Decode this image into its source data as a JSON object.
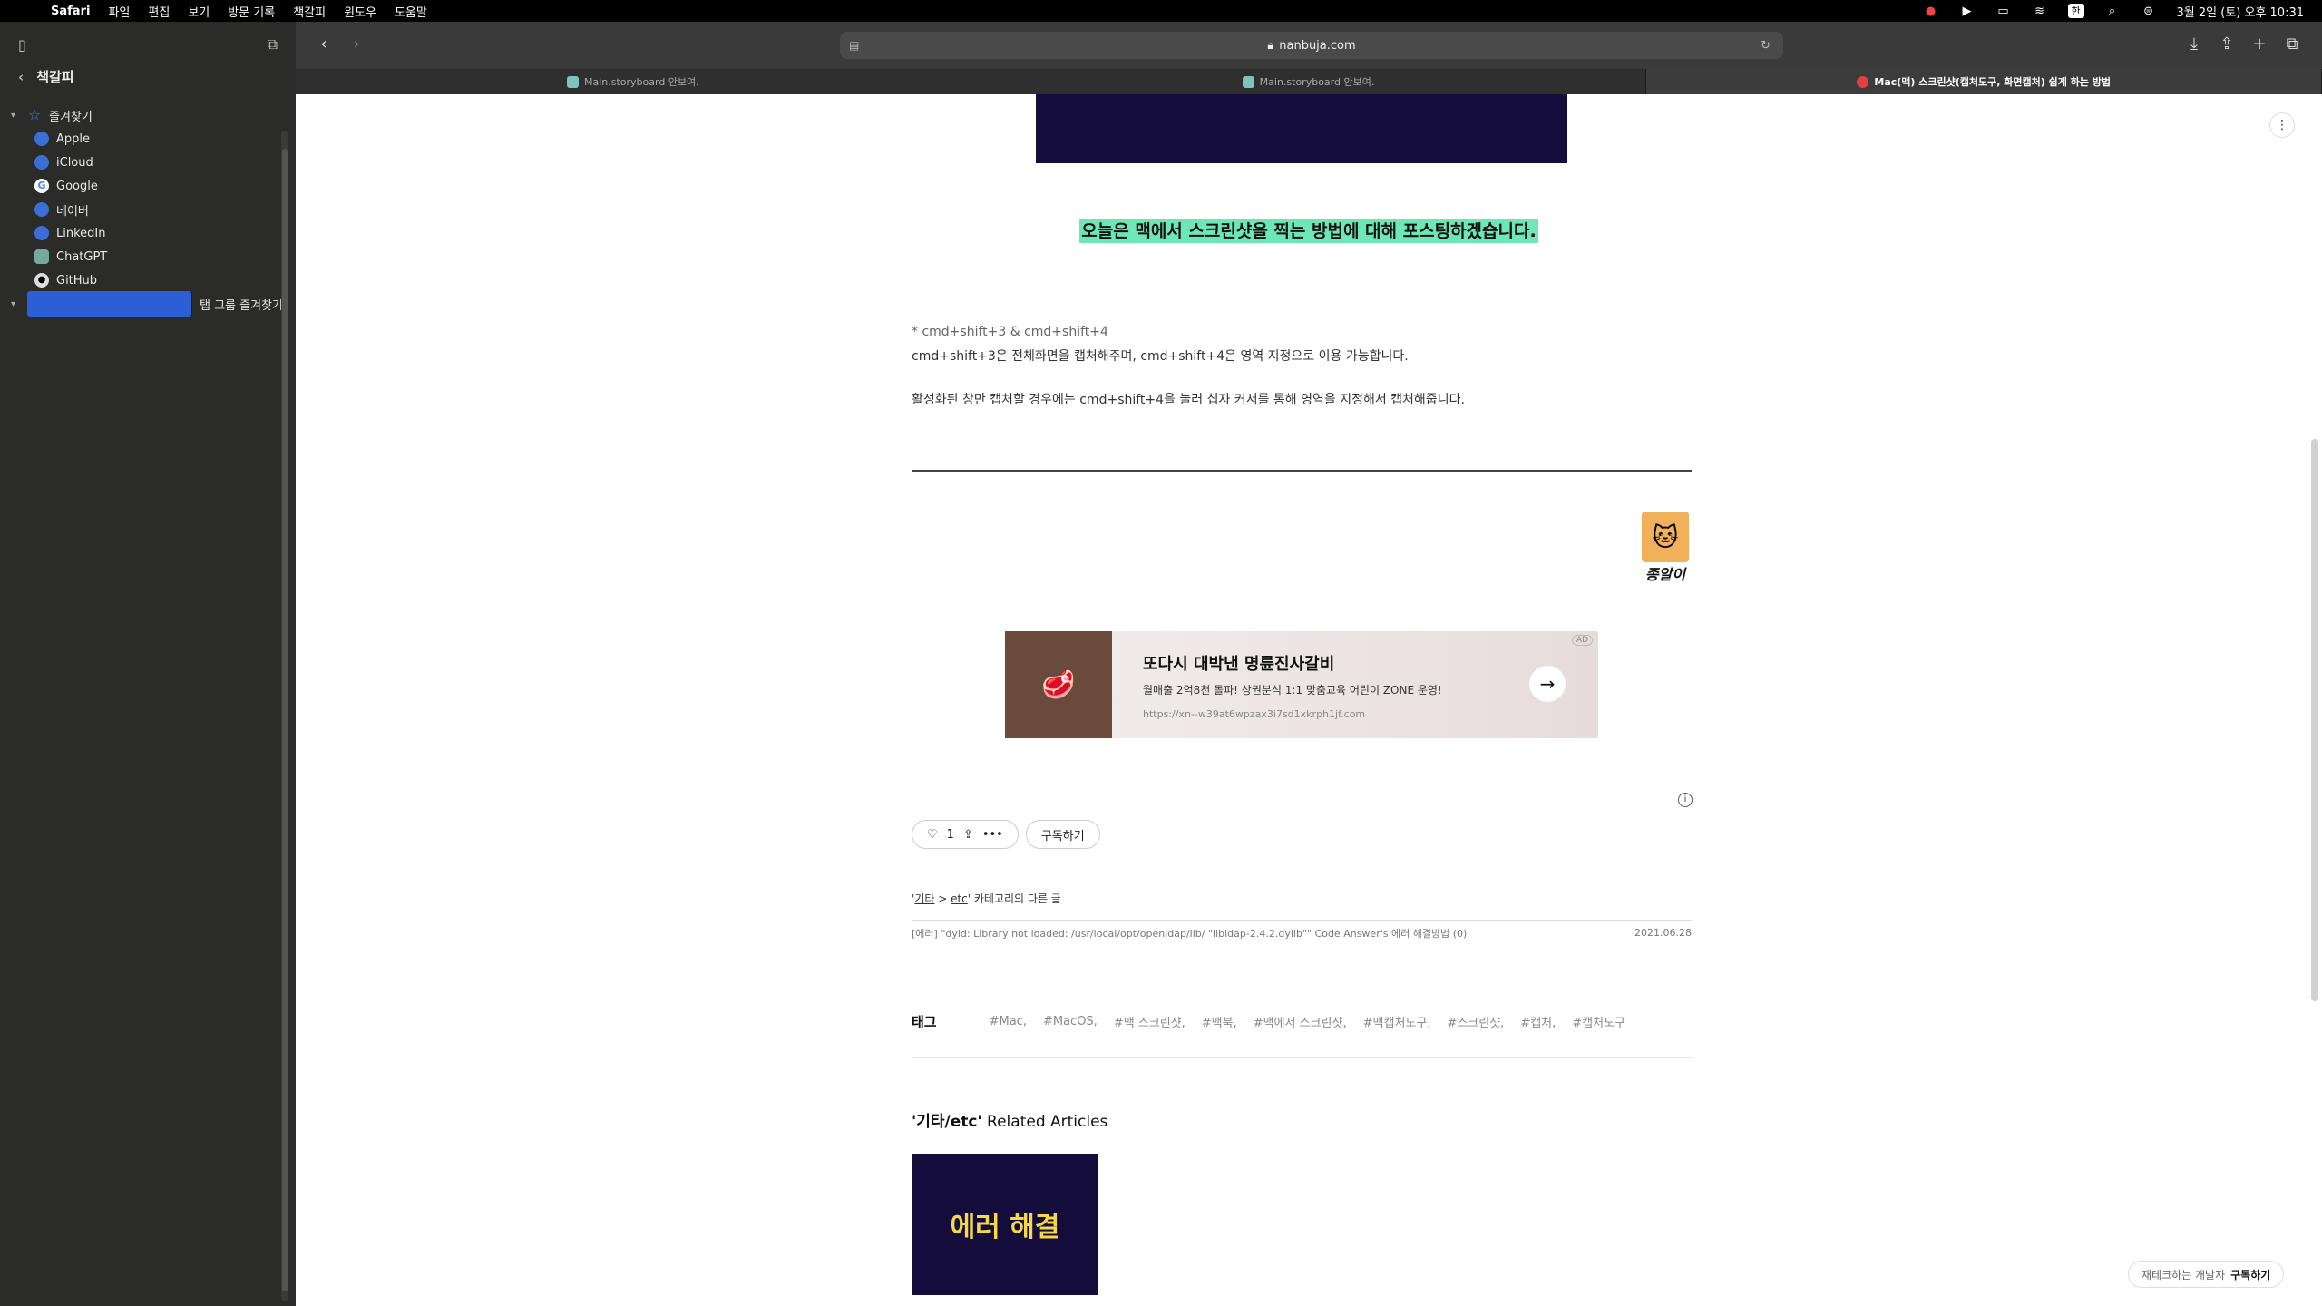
{
  "menubar": {
    "app": "Safari",
    "items": [
      "파일",
      "편집",
      "보기",
      "방문 기록",
      "책갈피",
      "윈도우",
      "도움말"
    ],
    "clock": "3월 2일 (토) 오후 10:31",
    "input_source": "한"
  },
  "sidebar": {
    "title": "책갈피",
    "folder_favorites": "즐겨찾기",
    "bookmarks": [
      "Apple",
      "iCloud",
      "Google",
      "네이버",
      "LinkedIn",
      "ChatGPT",
      "GitHub"
    ],
    "folder_tabgroups": "탭 그룹 즐겨찾기"
  },
  "toolbar": {
    "url": "nanbuja.com"
  },
  "tabs": [
    {
      "label": "Main.storyboard 안보여."
    },
    {
      "label": "Main.storyboard 안보여."
    },
    {
      "label": "Mac(맥) 스크린샷(캡처도구, 화면캡처) 쉽게 하는 방법"
    }
  ],
  "article": {
    "highlight": "오늘은 맥에서 스크린샷을 찍는 방법에 대해 포스팅하겠습니다.",
    "line1": "* cmd+shift+3 & cmd+shift+4",
    "line2": "cmd+shift+3은 전체화면을 캡처해주며, cmd+shift+4은 영역 지정으로 이용 가능합니다.",
    "line3": "활성화된 창만 캡처할 경우에는 cmd+shift+4을 눌러 십자 커서를 통해 영역을 지정해서 캡처해줍니다.",
    "author_name": "종알이"
  },
  "ad": {
    "title": "또다시 대박낸 명륜진사갈비",
    "subtitle": "월매출 2억8천 돌파! 상권분석 1:1 맞춤교육 어린이 ZONE 운영!",
    "url": "https://xn--w39at6wpzax3i7sd1xkrph1jf.com",
    "badge": "AD"
  },
  "actions": {
    "like_count": "1",
    "subscribe": "구독하기"
  },
  "category": {
    "cat1": "기타",
    "cat2": "etc",
    "suffix": "' 카테고리의 다른 글",
    "prefix": "'",
    "arrow": " > ",
    "post_title": "[에러] \"dyld: Library not loaded: /usr/local/opt/openldap/lib/ \"libldap-2.4.2.dylib\"\" Code Answer's 에러 해결방법",
    "post_count": "(0)",
    "post_date": "2021.06.28"
  },
  "tags": {
    "label": "태그",
    "items": [
      "#Mac,",
      "#MacOS,",
      "#맥 스크린샷,",
      "#맥북,",
      "#맥에서 스크린샷,",
      "#맥캡처도구,",
      "#스크린샷,",
      "#캡처,",
      "#캡처도구"
    ]
  },
  "related": {
    "bold": "'기타/etc'",
    "rest": " Related Articles",
    "card_text": "에러 해결"
  },
  "floating": {
    "prefix": "재테크하는 개발자",
    "action": "구독하기"
  }
}
